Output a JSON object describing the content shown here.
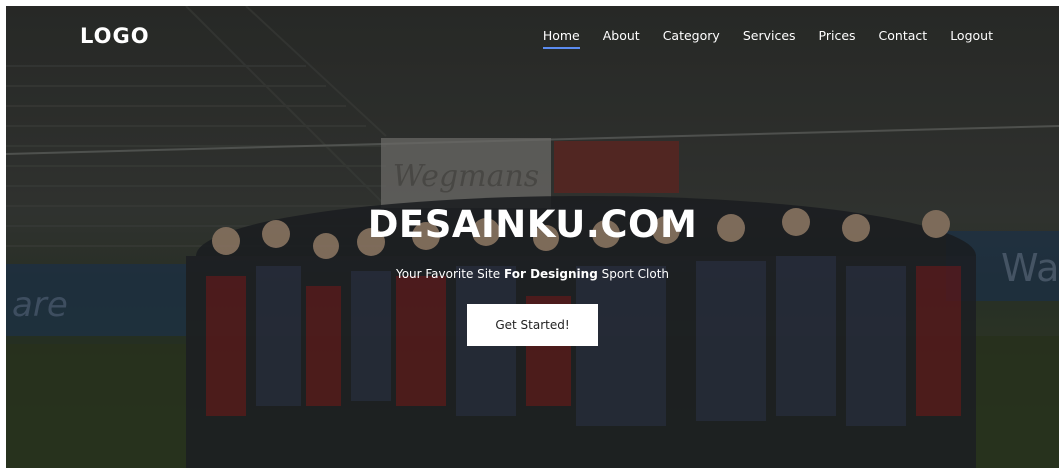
{
  "header": {
    "logo": "LOGO",
    "nav": [
      "Home",
      "About",
      "Category",
      "Services",
      "Prices",
      "Contact",
      "Logout"
    ],
    "active_nav": "Home",
    "accent_color": "#5b8cf0"
  },
  "hero": {
    "title": "DESAINKU.COM",
    "tagline_pre": "Your Favorite Site ",
    "tagline_bold": "For Designing",
    "tagline_post": " Sport Cloth",
    "cta_label": "Get Started!",
    "background": "stadium-team-huddle-photo"
  }
}
